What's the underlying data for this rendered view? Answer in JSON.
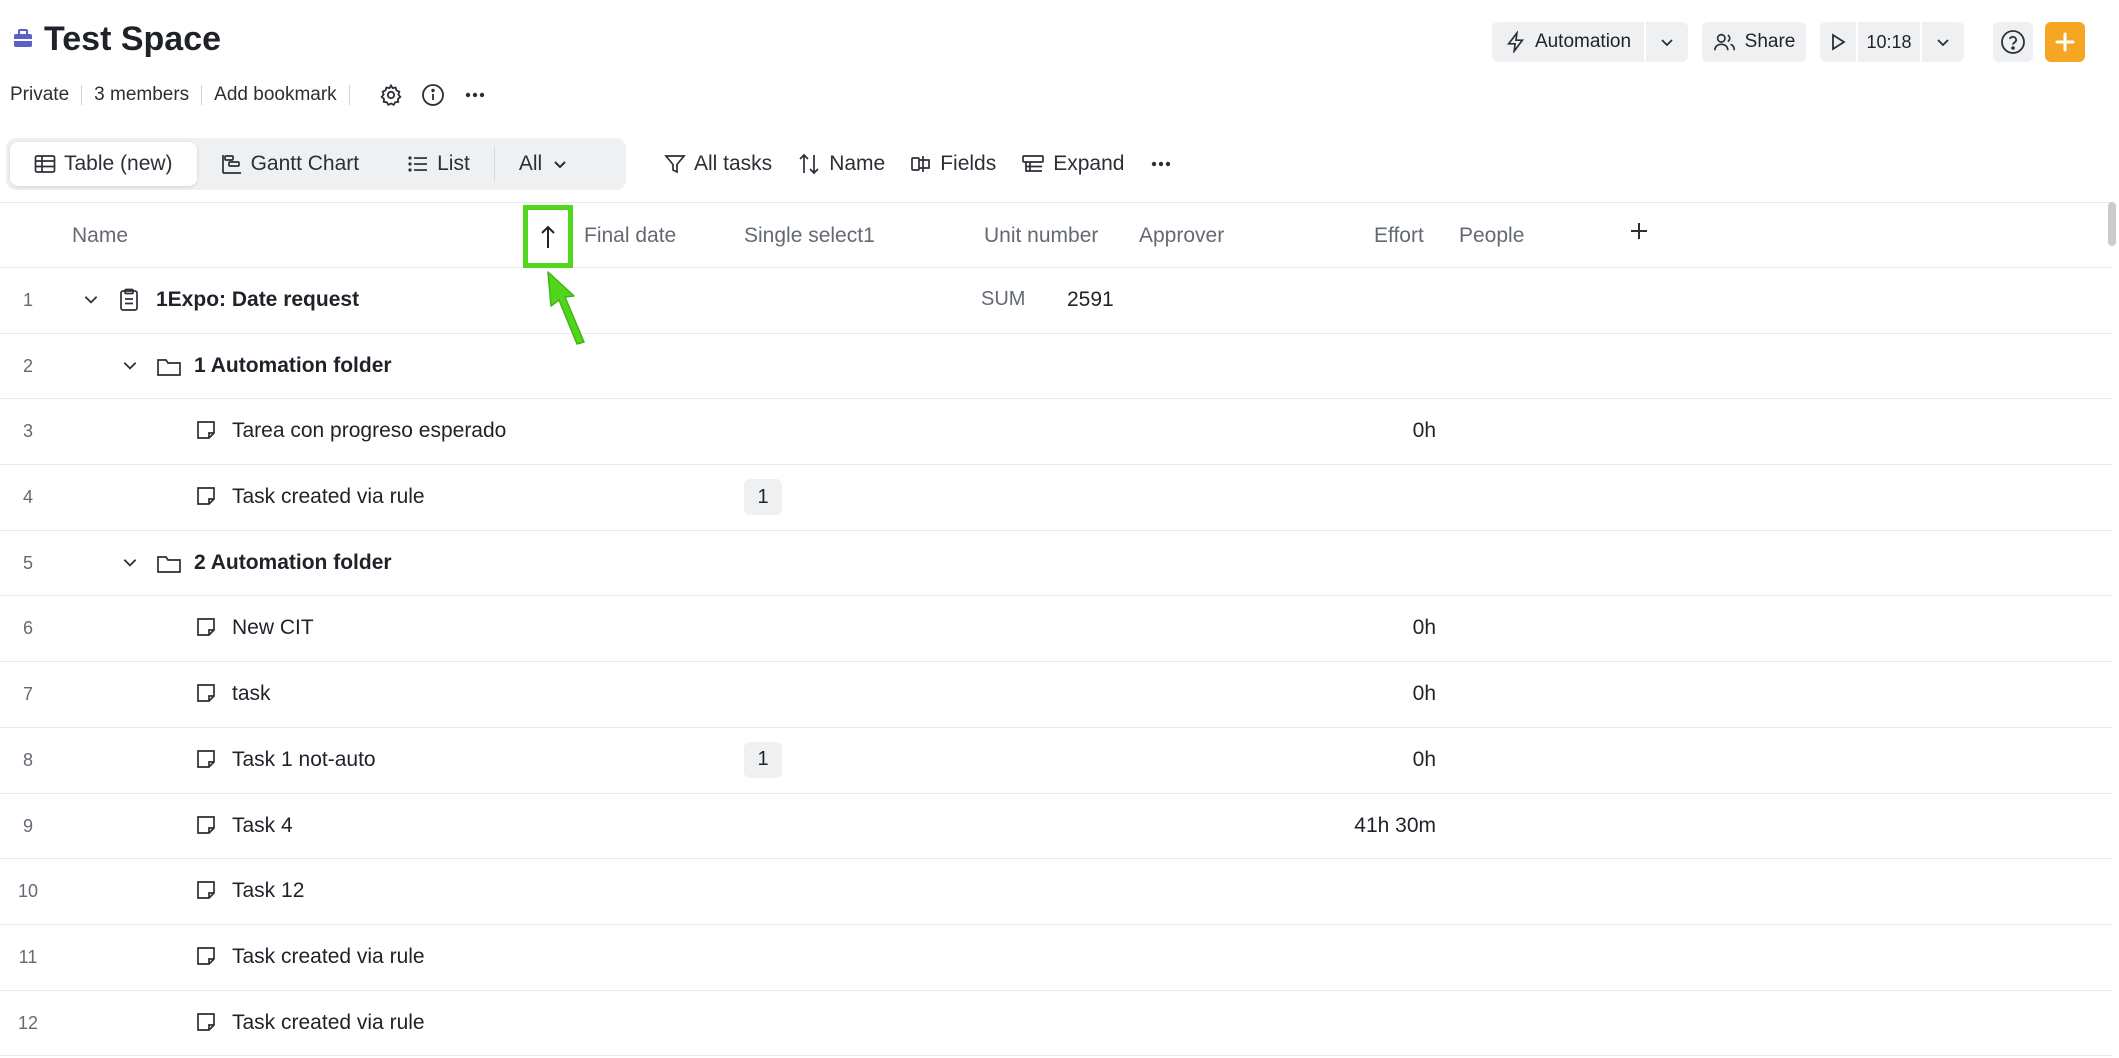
{
  "header": {
    "title": "Test Space",
    "meta": {
      "privacy": "Private",
      "members": "3 members",
      "bookmark": "Add bookmark"
    },
    "automation_label": "Automation",
    "share_label": "Share",
    "timer_value": "10:18"
  },
  "views": {
    "tabs": [
      {
        "label": "Table (new)"
      },
      {
        "label": "Gantt Chart"
      },
      {
        "label": "List"
      },
      {
        "label": "All"
      }
    ]
  },
  "toolbar": {
    "filter_label": "All tasks",
    "sort_label": "Name",
    "fields_label": "Fields",
    "expand_label": "Expand"
  },
  "table": {
    "columns": {
      "name": "Name",
      "final_date": "Final date",
      "single_select": "Single select1",
      "unit_number": "Unit number",
      "approver": "Approver",
      "effort": "Effort",
      "people": "People"
    },
    "rows": [
      {
        "num": "1",
        "name": "1Expo: Date request",
        "sum_label": "SUM",
        "unit_sum": "2591"
      },
      {
        "num": "2",
        "name": "1 Automation folder"
      },
      {
        "num": "3",
        "name": "Tarea con progreso esperado",
        "effort": "0h"
      },
      {
        "num": "4",
        "name": "Task created via rule",
        "select": "1"
      },
      {
        "num": "5",
        "name": "2 Automation folder"
      },
      {
        "num": "6",
        "name": "New CIT",
        "effort": "0h"
      },
      {
        "num": "7",
        "name": "task",
        "effort": "0h"
      },
      {
        "num": "8",
        "name": "Task 1 not-auto",
        "select": "1",
        "effort": "0h"
      },
      {
        "num": "9",
        "name": "Task 4",
        "effort": "41h 30m"
      },
      {
        "num": "10",
        "name": "Task 12"
      },
      {
        "num": "11",
        "name": "Task created via rule"
      },
      {
        "num": "12",
        "name": "Task created via rule"
      }
    ]
  },
  "icons": {
    "space": "briefcase-icon",
    "settings": "gear-icon",
    "info": "info-icon",
    "more": "more-icon",
    "automation": "lightning-icon",
    "share": "people-icon",
    "play": "play-icon",
    "help": "help-icon",
    "add": "plus-icon",
    "sort_dir": "arrow-up-icon"
  },
  "colors": {
    "accent_orange": "#f5a623",
    "highlight_green": "#52d61b",
    "icon_purple": "#5b5fc7"
  }
}
